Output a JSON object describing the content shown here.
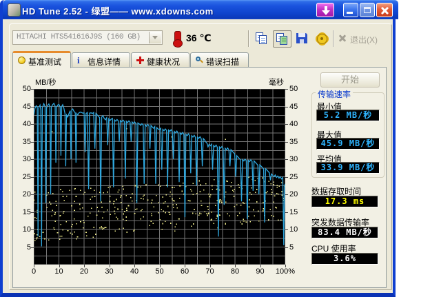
{
  "window": {
    "title": "HD Tune 2.52 - 绿盟—— www.xdowns.com"
  },
  "icons": {
    "app": "disk",
    "download": "arrow-down",
    "minimize": "underscore",
    "maximize": "square",
    "close": "x",
    "temperature": "thermometer",
    "copy": "pages",
    "copy_image": "pages-green",
    "save": "floppy-disk",
    "options": "gear",
    "exit": "x-mark",
    "tab_benchmark": "lightbulb",
    "tab_info": "info-i",
    "tab_health": "red-cross",
    "tab_scan": "magnifier"
  },
  "toolbar": {
    "drive_select": "HITACHI HTS541616J9S (160 GB)",
    "temperature": "36",
    "temperature_unit": "℃",
    "exit_label": "退出(X)"
  },
  "tabs": [
    {
      "label": "基准测试",
      "active": true
    },
    {
      "label": "信息详情",
      "active": false
    },
    {
      "label": "健康状况",
      "active": false
    },
    {
      "label": "错误扫描",
      "active": false
    }
  ],
  "benchmark": {
    "start_button": "开始",
    "stats": {
      "group_title": "传输速率",
      "min_label": "最小值",
      "min_value": "5.2 MB/秒",
      "max_label": "最大值",
      "max_value": "45.9 MB/秒",
      "avg_label": "平均值",
      "avg_value": "33.9 MB/秒",
      "access_label": "数据存取时间",
      "access_value": "17.3 ms",
      "burst_label": "突发数据传输率",
      "burst_value": "83.4 MB/秒",
      "cpu_label": "CPU 使用率",
      "cpu_value": "3.6%"
    }
  },
  "chart_data": {
    "type": "line",
    "title": "HD Tune benchmark: transfer rate (line) and access time (scatter)",
    "left_axis_label": "MB/秒",
    "right_axis_label": "毫秒",
    "x_range": [
      0,
      100
    ],
    "y_range": [
      0,
      50
    ],
    "y_ticks": [
      50,
      45,
      40,
      35,
      30,
      25,
      20,
      15,
      10,
      5
    ],
    "x_ticks": [
      "0",
      "10",
      "20",
      "30",
      "40",
      "50",
      "60",
      "70",
      "80",
      "90",
      "100%"
    ],
    "x_tick_positions": [
      0,
      10,
      20,
      30,
      40,
      50,
      60,
      70,
      80,
      90,
      100
    ],
    "grid": {
      "x_step": 5,
      "y_step": 2.5,
      "on": true
    },
    "colors": {
      "plot_bg": "#000000",
      "grid": "#767676",
      "line": "#2FA8DF",
      "scatter": "#EDE98A"
    },
    "legend": "none",
    "series": [
      {
        "name": "transfer-rate-mb-s",
        "type": "line",
        "points": [
          [
            0,
            42.5
          ],
          [
            0.5,
            44.5
          ],
          [
            1,
            45.2
          ],
          [
            1.4,
            44.8
          ],
          [
            1.7,
            8.0
          ],
          [
            2.0,
            44.6
          ],
          [
            2.5,
            45.4
          ],
          [
            2.8,
            44.0
          ],
          [
            3.1,
            5.2
          ],
          [
            3.4,
            44.6
          ],
          [
            4.0,
            45.8
          ],
          [
            4.5,
            45.0
          ],
          [
            4.8,
            17.5
          ],
          [
            5.1,
            44.6
          ],
          [
            5.5,
            45.3
          ],
          [
            6.0,
            45.7
          ],
          [
            6.4,
            44.9
          ],
          [
            6.7,
            20.0
          ],
          [
            7.0,
            44.8
          ],
          [
            7.5,
            45.5
          ],
          [
            8.0,
            45.9
          ],
          [
            8.5,
            45.1
          ],
          [
            8.8,
            29.0
          ],
          [
            9.1,
            44.9
          ],
          [
            9.5,
            45.4
          ],
          [
            10.0,
            45.6
          ],
          [
            10.5,
            44.8
          ],
          [
            10.8,
            31.0
          ],
          [
            11.1,
            45.0
          ],
          [
            11.5,
            45.5
          ],
          [
            12.0,
            44.4
          ],
          [
            12.4,
            43.0
          ],
          [
            12.7,
            28.0
          ],
          [
            13.0,
            42.6
          ],
          [
            13.5,
            42.0
          ],
          [
            14.0,
            43.0
          ],
          [
            14.5,
            43.8
          ],
          [
            14.8,
            30.0
          ],
          [
            15.1,
            44.0
          ],
          [
            15.5,
            44.3
          ],
          [
            16.0,
            43.6
          ],
          [
            16.5,
            43.2
          ],
          [
            16.8,
            29.0
          ],
          [
            17.1,
            43.0
          ],
          [
            17.5,
            42.6
          ],
          [
            18.0,
            43.2
          ],
          [
            18.5,
            43.4
          ],
          [
            19.0,
            43.3
          ],
          [
            19.5,
            43.1
          ],
          [
            20.0,
            43.2
          ],
          [
            20.4,
            32.0
          ],
          [
            20.8,
            43.0
          ],
          [
            21.3,
            43.3
          ],
          [
            21.8,
            21.5
          ],
          [
            22.2,
            43.1
          ],
          [
            22.8,
            43.2
          ],
          [
            23.3,
            43.0
          ],
          [
            23.8,
            43.3
          ],
          [
            24.3,
            33.0
          ],
          [
            24.7,
            43.0
          ],
          [
            25.2,
            42.6
          ],
          [
            25.7,
            42.2
          ],
          [
            26.2,
            41.8
          ],
          [
            26.6,
            18.0
          ],
          [
            27.0,
            42.0
          ],
          [
            27.5,
            42.4
          ],
          [
            28.0,
            41.6
          ],
          [
            28.5,
            41.2
          ],
          [
            29.0,
            41.8
          ],
          [
            29.4,
            34.0
          ],
          [
            29.8,
            41.5
          ],
          [
            30.3,
            41.0
          ],
          [
            30.8,
            41.4
          ],
          [
            31.3,
            41.6
          ],
          [
            31.7,
            22.0
          ],
          [
            32.1,
            41.2
          ],
          [
            32.6,
            40.8
          ],
          [
            33.1,
            41.3
          ],
          [
            33.6,
            40.9
          ],
          [
            34.0,
            35.0
          ],
          [
            34.4,
            41.0
          ],
          [
            35.0,
            40.6
          ],
          [
            35.5,
            41.1
          ],
          [
            36.0,
            40.7
          ],
          [
            36.4,
            24.5
          ],
          [
            36.8,
            40.8
          ],
          [
            37.3,
            40.4
          ],
          [
            37.8,
            40.9
          ],
          [
            38.3,
            40.5
          ],
          [
            38.7,
            35.0
          ],
          [
            39.1,
            40.6
          ],
          [
            39.6,
            40.2
          ],
          [
            40.1,
            40.6
          ],
          [
            40.6,
            40.1
          ],
          [
            41.0,
            17.5
          ],
          [
            41.4,
            40.3
          ],
          [
            42.0,
            40.0
          ],
          [
            42.5,
            39.6
          ],
          [
            43.0,
            40.1
          ],
          [
            43.5,
            39.7
          ],
          [
            43.9,
            23.0
          ],
          [
            44.3,
            39.8
          ],
          [
            44.8,
            39.4
          ],
          [
            45.3,
            39.9
          ],
          [
            45.8,
            39.5
          ],
          [
            46.2,
            33.0
          ],
          [
            46.6,
            39.6
          ],
          [
            47.1,
            39.2
          ],
          [
            47.6,
            38.8
          ],
          [
            48.1,
            39.3
          ],
          [
            48.5,
            23.0
          ],
          [
            48.9,
            39.0
          ],
          [
            49.4,
            38.6
          ],
          [
            50.0,
            38.4
          ],
          [
            50.5,
            38.8
          ],
          [
            50.9,
            27.0
          ],
          [
            51.3,
            38.5
          ],
          [
            51.8,
            38.1
          ],
          [
            52.3,
            38.6
          ],
          [
            52.8,
            38.2
          ],
          [
            53.2,
            22.0
          ],
          [
            53.6,
            38.3
          ],
          [
            54.1,
            37.9
          ],
          [
            54.6,
            38.4
          ],
          [
            55.1,
            37.8
          ],
          [
            55.5,
            30.0
          ],
          [
            55.9,
            37.9
          ],
          [
            56.4,
            37.5
          ],
          [
            56.9,
            38.0
          ],
          [
            57.4,
            37.4
          ],
          [
            57.8,
            23.5
          ],
          [
            58.2,
            37.5
          ],
          [
            58.7,
            37.1
          ],
          [
            59.2,
            37.6
          ],
          [
            59.7,
            37.0
          ],
          [
            60.1,
            13.5
          ],
          [
            60.5,
            37.1
          ],
          [
            61.0,
            36.7
          ],
          [
            61.5,
            37.2
          ],
          [
            62.0,
            36.6
          ],
          [
            62.4,
            26.0
          ],
          [
            62.8,
            36.7
          ],
          [
            63.3,
            36.3
          ],
          [
            63.8,
            36.8
          ],
          [
            64.3,
            36.2
          ],
          [
            64.7,
            22.5
          ],
          [
            65.1,
            36.3
          ],
          [
            65.6,
            35.9
          ],
          [
            66.1,
            36.4
          ],
          [
            66.6,
            35.8
          ],
          [
            67.0,
            28.0
          ],
          [
            67.4,
            35.9
          ],
          [
            67.9,
            35.5
          ],
          [
            68.4,
            34.9
          ],
          [
            68.9,
            34.5
          ],
          [
            69.3,
            33.5
          ],
          [
            69.7,
            34.2
          ],
          [
            70.2,
            33.8
          ],
          [
            70.7,
            34.3
          ],
          [
            71.1,
            27.0
          ],
          [
            71.5,
            33.9
          ],
          [
            72.0,
            33.5
          ],
          [
            72.5,
            34.0
          ],
          [
            73.0,
            33.4
          ],
          [
            73.4,
            8.0
          ],
          [
            73.8,
            33.5
          ],
          [
            74.3,
            33.1
          ],
          [
            74.8,
            33.6
          ],
          [
            75.3,
            33.0
          ],
          [
            75.7,
            17.0
          ],
          [
            76.1,
            33.1
          ],
          [
            76.6,
            32.7
          ],
          [
            77.1,
            33.2
          ],
          [
            77.6,
            32.6
          ],
          [
            78.0,
            28.0
          ],
          [
            78.4,
            32.7
          ],
          [
            78.9,
            32.3
          ],
          [
            79.4,
            31.9
          ],
          [
            79.9,
            31.5
          ],
          [
            80.3,
            25.0
          ],
          [
            80.7,
            31.0
          ],
          [
            81.2,
            30.6
          ],
          [
            81.7,
            30.2
          ],
          [
            82.2,
            29.8
          ],
          [
            82.6,
            18.0
          ],
          [
            83.0,
            29.9
          ],
          [
            83.5,
            29.5
          ],
          [
            84.0,
            30.0
          ],
          [
            84.5,
            29.6
          ],
          [
            84.9,
            13.0
          ],
          [
            85.3,
            29.7
          ],
          [
            85.8,
            29.3
          ],
          [
            86.3,
            29.8
          ],
          [
            86.8,
            29.4
          ],
          [
            87.2,
            21.0
          ],
          [
            87.6,
            29.5
          ],
          [
            88.1,
            29.1
          ],
          [
            88.6,
            28.7
          ],
          [
            89.1,
            28.3
          ],
          [
            89.5,
            20.0
          ],
          [
            89.9,
            28.4
          ],
          [
            90.4,
            28.0
          ],
          [
            90.9,
            27.6
          ],
          [
            91.4,
            27.2
          ],
          [
            91.8,
            12.0
          ],
          [
            92.2,
            27.3
          ],
          [
            92.7,
            26.9
          ],
          [
            93.2,
            26.5
          ],
          [
            93.7,
            26.1
          ],
          [
            94.1,
            24.0
          ],
          [
            94.5,
            25.8
          ],
          [
            95.0,
            25.4
          ],
          [
            95.5,
            25.0
          ],
          [
            96.0,
            25.5
          ],
          [
            96.5,
            24.8
          ],
          [
            97.0,
            25.2
          ],
          [
            97.5,
            24.6
          ],
          [
            98.0,
            25.0
          ],
          [
            98.5,
            24.4
          ],
          [
            99.0,
            24.8
          ],
          [
            99.4,
            5.5
          ],
          [
            99.7,
            22.5
          ],
          [
            100,
            23.0
          ]
        ]
      },
      {
        "name": "access-time-ms",
        "type": "scatter",
        "band": {
          "count": 380,
          "seed": 7,
          "y_low_start": 6.3,
          "y_low_end": 12.0,
          "y_high_start": 21.0,
          "y_high_end": 25.5,
          "stray_rate": 0.015,
          "stray_y_min": 26,
          "stray_y_max": 46
        }
      }
    ]
  }
}
